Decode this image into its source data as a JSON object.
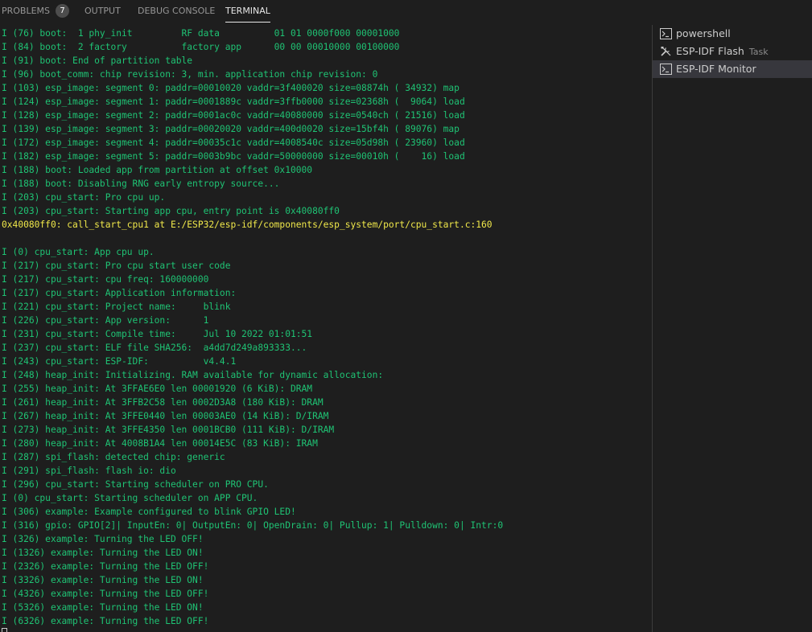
{
  "panel": {
    "tabs": [
      {
        "label": "PROBLEMS",
        "badge": "7"
      },
      {
        "label": "OUTPUT"
      },
      {
        "label": "DEBUG CONSOLE"
      },
      {
        "label": "TERMINAL",
        "active": true
      }
    ]
  },
  "terminals": [
    {
      "icon": "terminal-icon",
      "label": "powershell",
      "sub": ""
    },
    {
      "icon": "tools-icon",
      "label": "ESP-IDF Flash",
      "sub": "Task"
    },
    {
      "icon": "terminal-icon",
      "label": "ESP-IDF Monitor",
      "sub": "",
      "selected": true
    }
  ],
  "output_lines": [
    {
      "text": "I (76) boot:  1 phy_init         RF data          01 01 0000f000 00001000"
    },
    {
      "text": "I (84) boot:  2 factory          factory app      00 00 00010000 00100000"
    },
    {
      "text": "I (91) boot: End of partition table"
    },
    {
      "text": "I (96) boot_comm: chip revision: 3, min. application chip revision: 0"
    },
    {
      "text": "I (103) esp_image: segment 0: paddr=00010020 vaddr=3f400020 size=08874h ( 34932) map"
    },
    {
      "text": "I (124) esp_image: segment 1: paddr=0001889c vaddr=3ffb0000 size=02368h (  9064) load"
    },
    {
      "text": "I (128) esp_image: segment 2: paddr=0001ac0c vaddr=40080000 size=0540ch ( 21516) load"
    },
    {
      "text": "I (139) esp_image: segment 3: paddr=00020020 vaddr=400d0020 size=15bf4h ( 89076) map"
    },
    {
      "text": "I (172) esp_image: segment 4: paddr=00035c1c vaddr=4008540c size=05d98h ( 23960) load"
    },
    {
      "text": "I (182) esp_image: segment 5: paddr=0003b9bc vaddr=50000000 size=00010h (    16) load"
    },
    {
      "text": "I (188) boot: Loaded app from partition at offset 0x10000"
    },
    {
      "text": "I (188) boot: Disabling RNG early entropy source..."
    },
    {
      "text": "I (203) cpu_start: Pro cpu up."
    },
    {
      "text": "I (203) cpu_start: Starting app cpu, entry point is 0x40080ff0"
    },
    {
      "text": "0x40080ff0: call_start_cpu1 at E:/ESP32/esp-idf/components/esp_system/port/cpu_start.c:160",
      "style": "warn"
    },
    {
      "text": ""
    },
    {
      "text": "I (0) cpu_start: App cpu up."
    },
    {
      "text": "I (217) cpu_start: Pro cpu start user code"
    },
    {
      "text": "I (217) cpu_start: cpu freq: 160000000"
    },
    {
      "text": "I (217) cpu_start: Application information:"
    },
    {
      "text": "I (221) cpu_start: Project name:     blink"
    },
    {
      "text": "I (226) cpu_start: App version:      1"
    },
    {
      "text": "I (231) cpu_start: Compile time:     Jul 10 2022 01:01:51"
    },
    {
      "text": "I (237) cpu_start: ELF file SHA256:  a4dd7d249a893333..."
    },
    {
      "text": "I (243) cpu_start: ESP-IDF:          v4.4.1"
    },
    {
      "text": "I (248) heap_init: Initializing. RAM available for dynamic allocation:"
    },
    {
      "text": "I (255) heap_init: At 3FFAE6E0 len 00001920 (6 KiB): DRAM"
    },
    {
      "text": "I (261) heap_init: At 3FFB2C58 len 0002D3A8 (180 KiB): DRAM"
    },
    {
      "text": "I (267) heap_init: At 3FFE0440 len 00003AE0 (14 KiB): D/IRAM"
    },
    {
      "text": "I (273) heap_init: At 3FFE4350 len 0001BCB0 (111 KiB): D/IRAM"
    },
    {
      "text": "I (280) heap_init: At 4008B1A4 len 00014E5C (83 KiB): IRAM"
    },
    {
      "text": "I (287) spi_flash: detected chip: generic"
    },
    {
      "text": "I (291) spi_flash: flash io: dio"
    },
    {
      "text": "I (296) cpu_start: Starting scheduler on PRO CPU."
    },
    {
      "text": "I (0) cpu_start: Starting scheduler on APP CPU."
    },
    {
      "text": "I (306) example: Example configured to blink GPIO LED!"
    },
    {
      "text": "I (316) gpio: GPIO[2]| InputEn: 0| OutputEn: 0| OpenDrain: 0| Pullup: 1| Pulldown: 0| Intr:0"
    },
    {
      "text": "I (326) example: Turning the LED OFF!"
    },
    {
      "text": "I (1326) example: Turning the LED ON!"
    },
    {
      "text": "I (2326) example: Turning the LED OFF!"
    },
    {
      "text": "I (3326) example: Turning the LED ON!"
    },
    {
      "text": "I (4326) example: Turning the LED OFF!"
    },
    {
      "text": "I (5326) example: Turning the LED ON!"
    },
    {
      "text": "I (6326) example: Turning the LED OFF!"
    }
  ],
  "colors": {
    "background": "#1e1e1e",
    "output_text": "#1fc374",
    "warning_text": "#f0e84a",
    "selected_row": "#37373d"
  }
}
